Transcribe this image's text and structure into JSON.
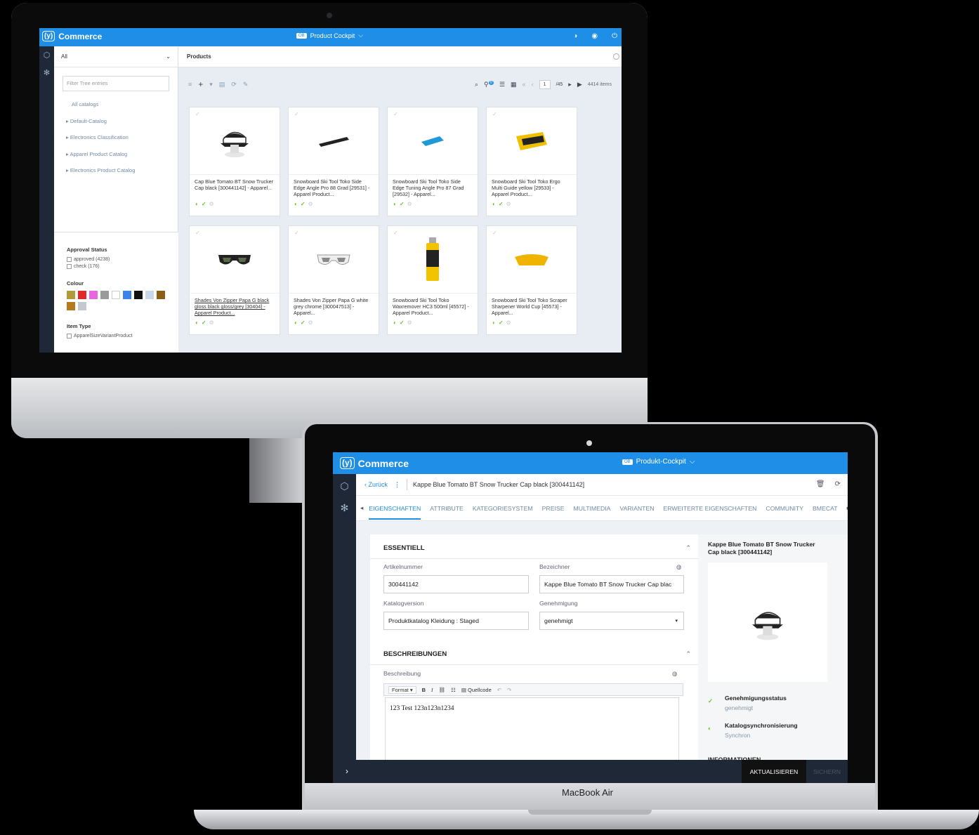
{
  "brand": {
    "logo_glyph": "(y)",
    "name": "Commerce",
    "color": "#1e8ee6"
  },
  "imac": {
    "perspective": {
      "badge": "OB",
      "label": "Product Cockpit"
    },
    "tree": {
      "selector": "All",
      "filter_placeholder": "Filter Tree entries",
      "items": [
        "All catalogs",
        "Default-Catalog",
        "Electronics Classification",
        "Apparel Product Catalog",
        "Electronics Product Catalog"
      ]
    },
    "facets": {
      "approval_title": "Approval Status",
      "approval": [
        {
          "label": "approved (4238)"
        },
        {
          "label": "check (176)"
        }
      ],
      "colour_title": "Colour",
      "colours": [
        "#b19a3a",
        "#e3262a",
        "#e866e0",
        "#9a9a9a",
        "#ffffff",
        "#3a83e8",
        "#111111",
        "#c9d9ea",
        "#8c5e16",
        "#b37a1e",
        "#c5c9cf"
      ],
      "item_type_title": "Item Type",
      "item_type": "ApparelSizeVariantProduct"
    },
    "products": {
      "header": "Products",
      "page": "1",
      "page_total": "/45",
      "items_count": "4414 items",
      "filter_badge": "0",
      "cards": [
        {
          "title": "Cap Blue Tomato BT Snow Trucker Cap black [300441142] - Apparel..."
        },
        {
          "title": "Snowboard Ski Tool Toko Side Edge Angle Pro 88 Grad [29531] - Apparel Product..."
        },
        {
          "title": "Snowboard Ski Tool Toko Side Edge Tuning Angle Pro 87 Grad [29532] - Apparel..."
        },
        {
          "title": "Snowboard Ski Tool Toko Ergo Multi Guide yellow [29533] - Apparel Product..."
        },
        {
          "title": "Shades Von Zipper Papa G black gloss black gloss/grey [30404] - Apparel Product..."
        },
        {
          "title": "Shades Von Zipper Papa G white grey chrome [300047513] - Apparel..."
        },
        {
          "title": "Snowboard Ski Tool Toko Waxremover HC3 500ml [45572] - Apparel Product..."
        },
        {
          "title": "Snowboard Ski Tool Toko Scraper Sharpener World Cup [45573] - Apparel..."
        }
      ]
    }
  },
  "macbook": {
    "label": "MacBook Air",
    "perspective": {
      "badge": "OB",
      "label": "Produkt-Cockpit"
    },
    "back": "‹ Zurück",
    "title": "Kappe Blue Tomato BT Snow Trucker Cap black [300441142]",
    "tabs": [
      "EIGENSCHAFTEN",
      "ATTRIBUTE",
      "KATEGORIESYSTEM",
      "PREISE",
      "MULTIMEDIA",
      "VARIANTEN",
      "ERWEITERTE EIGENSCHAFTEN",
      "COMMUNITY",
      "BMECAT"
    ],
    "essentiell": {
      "title": "ESSENTIELL",
      "artikelnummer_label": "Artikelnummer",
      "artikelnummer": "300441142",
      "bezeichner_label": "Bezeichner",
      "bezeichner": "Kappe Blue Tomato BT Snow Trucker Cap blac",
      "katalogversion_label": "Katalogversion",
      "katalogversion": "Produktkatalog Kleidung : Staged",
      "genehmigung_label": "Genehmigung",
      "genehmigung": "genehmigt"
    },
    "beschreibungen": {
      "title": "BESCHREIBUNGEN",
      "label": "Beschreibung",
      "format": "Format",
      "source": "Quellcode",
      "content": "123 Test 123n123n1234"
    },
    "preview": {
      "title": "Kappe Blue Tomato BT Snow Trucker Cap black [300441142]",
      "status1_name": "Genehmigungsstatus",
      "status1_value": "genehmigt",
      "status2_name": "Katalogsynchronisierung",
      "status2_value": "Synchron",
      "info": "INFORMATIONEN"
    },
    "buttons": {
      "update": "AKTUALISIEREN",
      "save": "SICHERN"
    }
  }
}
